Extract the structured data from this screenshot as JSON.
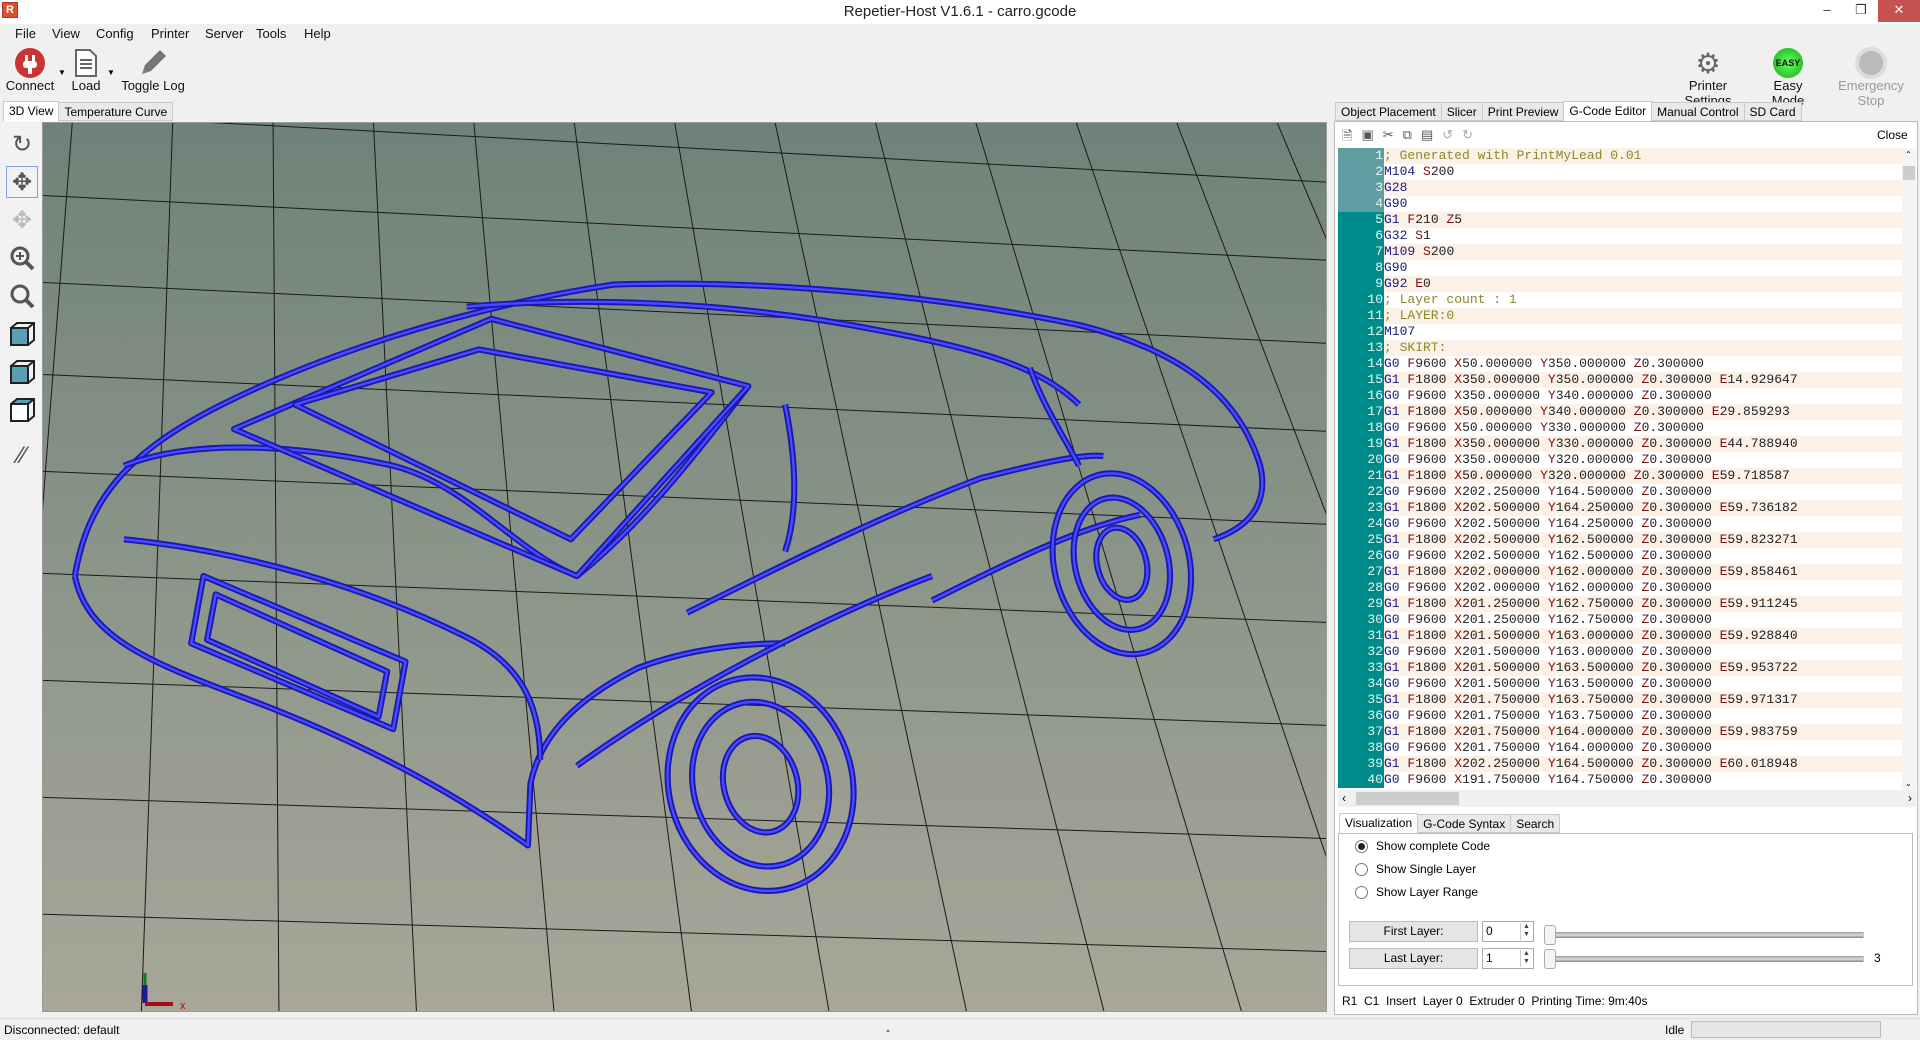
{
  "window": {
    "title": "Repetier-Host V1.6.1 - carro.gcode",
    "logo_letter": "R"
  },
  "menu": [
    "File",
    "View",
    "Config",
    "Printer",
    "Server",
    "Tools",
    "Help"
  ],
  "toolbar": {
    "connect": "Connect",
    "load": "Load",
    "toggle_log": "Toggle Log",
    "printer_settings": "Printer Settings",
    "easy_mode": "Easy Mode",
    "easy_badge": "EASY",
    "emergency_stop": "Emergency Stop"
  },
  "left_tabs": [
    "3D View",
    "Temperature Curve"
  ],
  "right_tabs": [
    "Object Placement",
    "Slicer",
    "Print Preview",
    "G-Code Editor",
    "Manual Control",
    "SD Card"
  ],
  "editor": {
    "close": "Close",
    "lines": [
      "; Generated with PrintMyLead 0.01",
      "M104 S200",
      "G28",
      "G90",
      "G1 F210 Z5",
      "G32 S1",
      "M109 S200",
      "G90",
      "G92 E0",
      "; Layer count : 1",
      "; LAYER:0",
      "M107",
      "; SKIRT:",
      "G0 F9600 X50.000000 Y350.000000 Z0.300000",
      "G1 F1800 X350.000000 Y350.000000 Z0.300000 E14.929647",
      "G0 F9600 X350.000000 Y340.000000 Z0.300000",
      "G1 F1800 X50.000000 Y340.000000 Z0.300000 E29.859293",
      "G0 F9600 X50.000000 Y330.000000 Z0.300000",
      "G1 F1800 X350.000000 Y330.000000 Z0.300000 E44.788940",
      "G0 F9600 X350.000000 Y320.000000 Z0.300000",
      "G1 F1800 X50.000000 Y320.000000 Z0.300000 E59.718587",
      "G0 F9600 X202.250000 Y164.500000 Z0.300000",
      "G1 F1800 X202.500000 Y164.250000 Z0.300000 E59.736182",
      "G0 F9600 X202.500000 Y164.250000 Z0.300000",
      "G1 F1800 X202.500000 Y162.500000 Z0.300000 E59.823271",
      "G0 F9600 X202.500000 Y162.500000 Z0.300000",
      "G1 F1800 X202.000000 Y162.000000 Z0.300000 E59.858461",
      "G0 F9600 X202.000000 Y162.000000 Z0.300000",
      "G1 F1800 X201.250000 Y162.750000 Z0.300000 E59.911245",
      "G0 F9600 X201.250000 Y162.750000 Z0.300000",
      "G1 F1800 X201.500000 Y163.000000 Z0.300000 E59.928840",
      "G0 F9600 X201.500000 Y163.000000 Z0.300000",
      "G1 F1800 X201.500000 Y163.500000 Z0.300000 E59.953722",
      "G0 F9600 X201.500000 Y163.500000 Z0.300000",
      "G1 F1800 X201.750000 Y163.750000 Z0.300000 E59.971317",
      "G0 F9600 X201.750000 Y163.750000 Z0.300000",
      "G1 F1800 X201.750000 Y164.000000 Z0.300000 E59.983759",
      "G0 F9600 X201.750000 Y164.000000 Z0.300000",
      "G1 F1800 X202.250000 Y164.500000 Z0.300000 E60.018948",
      "G0 F9600 X191.750000 Y164.750000 Z0.300000"
    ]
  },
  "bottom_tabs": [
    "Visualization",
    "G-Code Syntax",
    "Search"
  ],
  "visualization": {
    "options": [
      "Show complete Code",
      "Show Single Layer",
      "Show Layer Range"
    ],
    "selected": 0,
    "first_layer_label": "First Layer:",
    "first_layer_value": "0",
    "last_layer_label": "Last Layer:",
    "last_layer_value": "1",
    "max_layer": "3"
  },
  "editor_status": "R1  C1  Insert  Layer 0  Extruder 0  Printing Time: 9m:40s",
  "status": {
    "connection": "Disconnected: default",
    "middle": "-",
    "state": "Idle"
  },
  "colors": {
    "toolpath": "#2a2ae6",
    "gutter": "#008b8b",
    "gutter_header": "#5f9ea0",
    "viewport_top": "#6f8279",
    "viewport_bottom": "#a8a799"
  },
  "axis_labels": {
    "x": "x"
  }
}
